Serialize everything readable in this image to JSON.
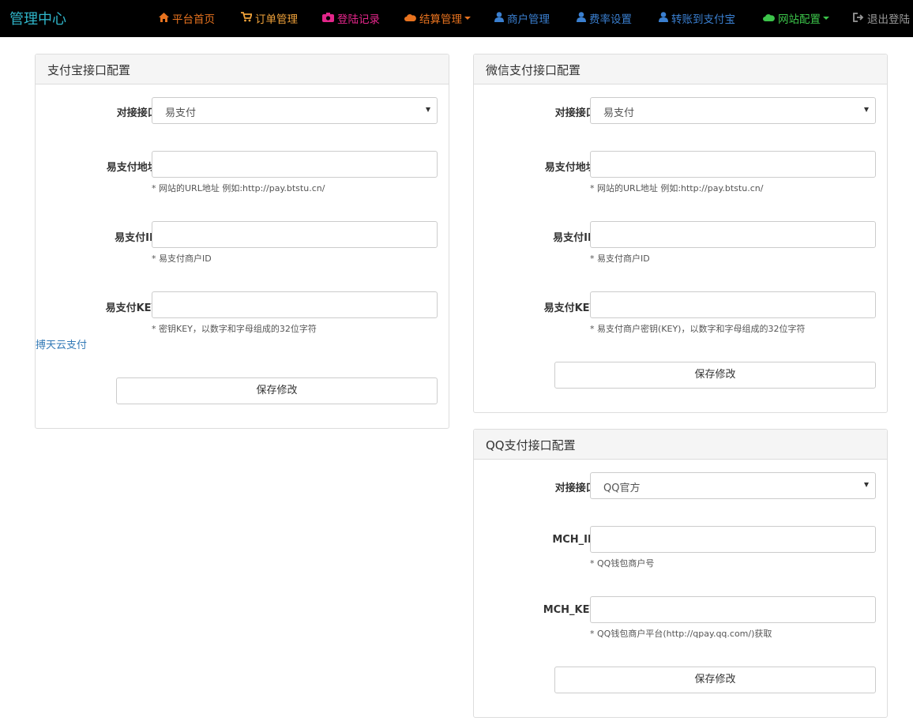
{
  "nav": {
    "brand": "管理中心",
    "items": [
      {
        "label": "平台首页",
        "icon": "home-icon",
        "color": "#e8731f"
      },
      {
        "label": "订单管理",
        "icon": "cart-icon",
        "color": "#f0a23a"
      },
      {
        "label": "登陆记录",
        "icon": "camera-icon",
        "color": "#e3268a"
      },
      {
        "label": "结算管理",
        "icon": "cloud-icon",
        "color": "#e8731f"
      },
      {
        "label": "商户管理",
        "icon": "user-icon",
        "color": "#3a7fd0"
      },
      {
        "label": "费率设置",
        "icon": "user-icon",
        "color": "#3a7fd0"
      },
      {
        "label": "转账到支付宝",
        "icon": "user-icon",
        "color": "#3a7fd0"
      },
      {
        "label": "网站配置",
        "icon": "cloud-icon",
        "color": "#3cc44a"
      },
      {
        "label": "退出登陆",
        "icon": "logout-icon",
        "color": "#999999"
      }
    ]
  },
  "alipay": {
    "title": "支付宝接口配置",
    "interface_label": "对接接口:",
    "interface_value": "易支付",
    "url_label": "易支付地址:",
    "url_value": "",
    "url_help": "* 网站的URL地址 例如:http://pay.btstu.cn/",
    "id_label": "易支付ID:",
    "id_value": "",
    "id_help": "* 易支付商户ID",
    "key_label": "易支付KEY:",
    "key_value": "",
    "key_help": "* 密钥KEY，以数字和字母组成的32位字符",
    "link": "搏天云支付",
    "save": "保存修改"
  },
  "wechat": {
    "title": "微信支付接口配置",
    "interface_label": "对接接口:",
    "interface_value": "易支付",
    "url_label": "易支付地址:",
    "url_value": "",
    "url_help": "* 网站的URL地址 例如:http://pay.btstu.cn/",
    "id_label": "易支付ID:",
    "id_value": "",
    "id_help": "* 易支付商户ID",
    "key_label": "易支付KEY:",
    "key_value": "",
    "key_help": "* 易支付商户密钥(KEY)，以数字和字母组成的32位字符",
    "save": "保存修改"
  },
  "qq": {
    "title": "QQ支付接口配置",
    "interface_label": "对接接口:",
    "interface_value": "QQ官方",
    "mchid_label": "MCH_ID:",
    "mchid_value": "",
    "mchid_help": "* QQ钱包商户号",
    "mchkey_label": "MCH_KEY:",
    "mchkey_value": "",
    "mchkey_help": "* QQ钱包商户平台(http://qpay.qq.com/)获取",
    "save": "保存修改"
  }
}
